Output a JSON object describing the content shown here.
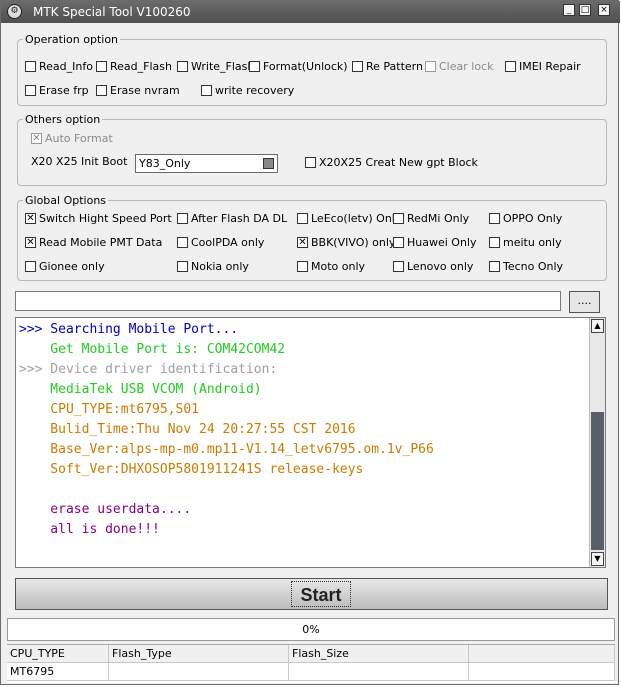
{
  "window": {
    "title": "MTK Special Tool V100260",
    "min": "_",
    "max": "□",
    "close": "×"
  },
  "operation": {
    "legend": "Operation option",
    "items": [
      {
        "label": "Read_Info",
        "checked": false
      },
      {
        "label": "Read_Flash",
        "checked": false
      },
      {
        "label": "Write_Flash",
        "checked": false
      },
      {
        "label": "Format(Unlock)",
        "checked": false
      },
      {
        "label": "Re Pattern lo",
        "checked": false
      },
      {
        "label": "Clear lock",
        "checked": false,
        "disabled": true
      },
      {
        "label": "IMEI Repair",
        "checked": false
      },
      {
        "label": "Erase frp",
        "checked": false
      },
      {
        "label": "Erase nvram",
        "checked": false
      },
      {
        "label": "write recovery",
        "checked": false
      }
    ]
  },
  "others": {
    "legend": "Others option",
    "auto_format": {
      "label": "Auto Format",
      "checked": true,
      "disabled": true
    },
    "init_boot_label": "X20 X25 Init Boot",
    "init_boot_value": "Y83_Only",
    "gpt": {
      "label": "X20X25 Creat New gpt Block",
      "checked": false
    }
  },
  "global": {
    "legend": "Global Options",
    "items": [
      {
        "label": "Switch Hight Speed Port",
        "checked": true
      },
      {
        "label": "After Flash DA DL",
        "checked": false
      },
      {
        "label": "LeEco(letv) Only",
        "checked": false
      },
      {
        "label": "RedMi Only",
        "checked": false
      },
      {
        "label": "OPPO Only",
        "checked": false
      },
      {
        "label": "Read Mobile PMT Data",
        "checked": true
      },
      {
        "label": "CoolPDA only",
        "checked": false
      },
      {
        "label": "BBK(VIVO) only",
        "checked": true
      },
      {
        "label": "Huawei Only",
        "checked": false
      },
      {
        "label": "meitu only",
        "checked": false
      },
      {
        "label": "Gionee only",
        "checked": false
      },
      {
        "label": "Nokia only",
        "checked": false
      },
      {
        "label": "Moto only",
        "checked": false
      },
      {
        "label": "Lenovo only",
        "checked": false
      },
      {
        "label": "Tecno Only",
        "checked": false
      }
    ]
  },
  "path": {
    "value": "",
    "browse_label": "...."
  },
  "log": {
    "lines": [
      {
        "text": ">>> Searching Mobile Port...",
        "color": "#0000cc"
      },
      {
        "text": "    Get Mobile Port is: COM42COM42",
        "color": "#22cc22"
      },
      {
        "text": ">>> Device driver identification:",
        "color": "#a0a0a0"
      },
      {
        "text": "    MediaTek USB VCOM (Android)",
        "color": "#22cc22"
      },
      {
        "text": "    CPU_TYPE:mt6795,S01",
        "color": "#cc7a00"
      },
      {
        "text": "    Bulid_Time:Thu Nov 24 20:27:55 CST 2016",
        "color": "#cc7a00"
      },
      {
        "text": "    Base_Ver:alps-mp-m0.mp11-V1.14_letv6795.om.1v_P66",
        "color": "#cc7a00"
      },
      {
        "text": "    Soft_Ver:DHXOSOP5801911241S release-keys",
        "color": "#cc7a00"
      },
      {
        "text": "",
        "color": "#000000"
      },
      {
        "text": "    erase userdata....",
        "color": "#880088"
      },
      {
        "text": "    all is done!!!",
        "color": "#880088"
      }
    ]
  },
  "start": {
    "label": "Start"
  },
  "progress": {
    "percent": 0,
    "text": "0%",
    "color": "#3a8ee6"
  },
  "table": {
    "headers": [
      "CPU_TYPE",
      "Flash_Type",
      "Flash_Size",
      ""
    ],
    "row": [
      "MT6795",
      "",
      "",
      ""
    ]
  }
}
